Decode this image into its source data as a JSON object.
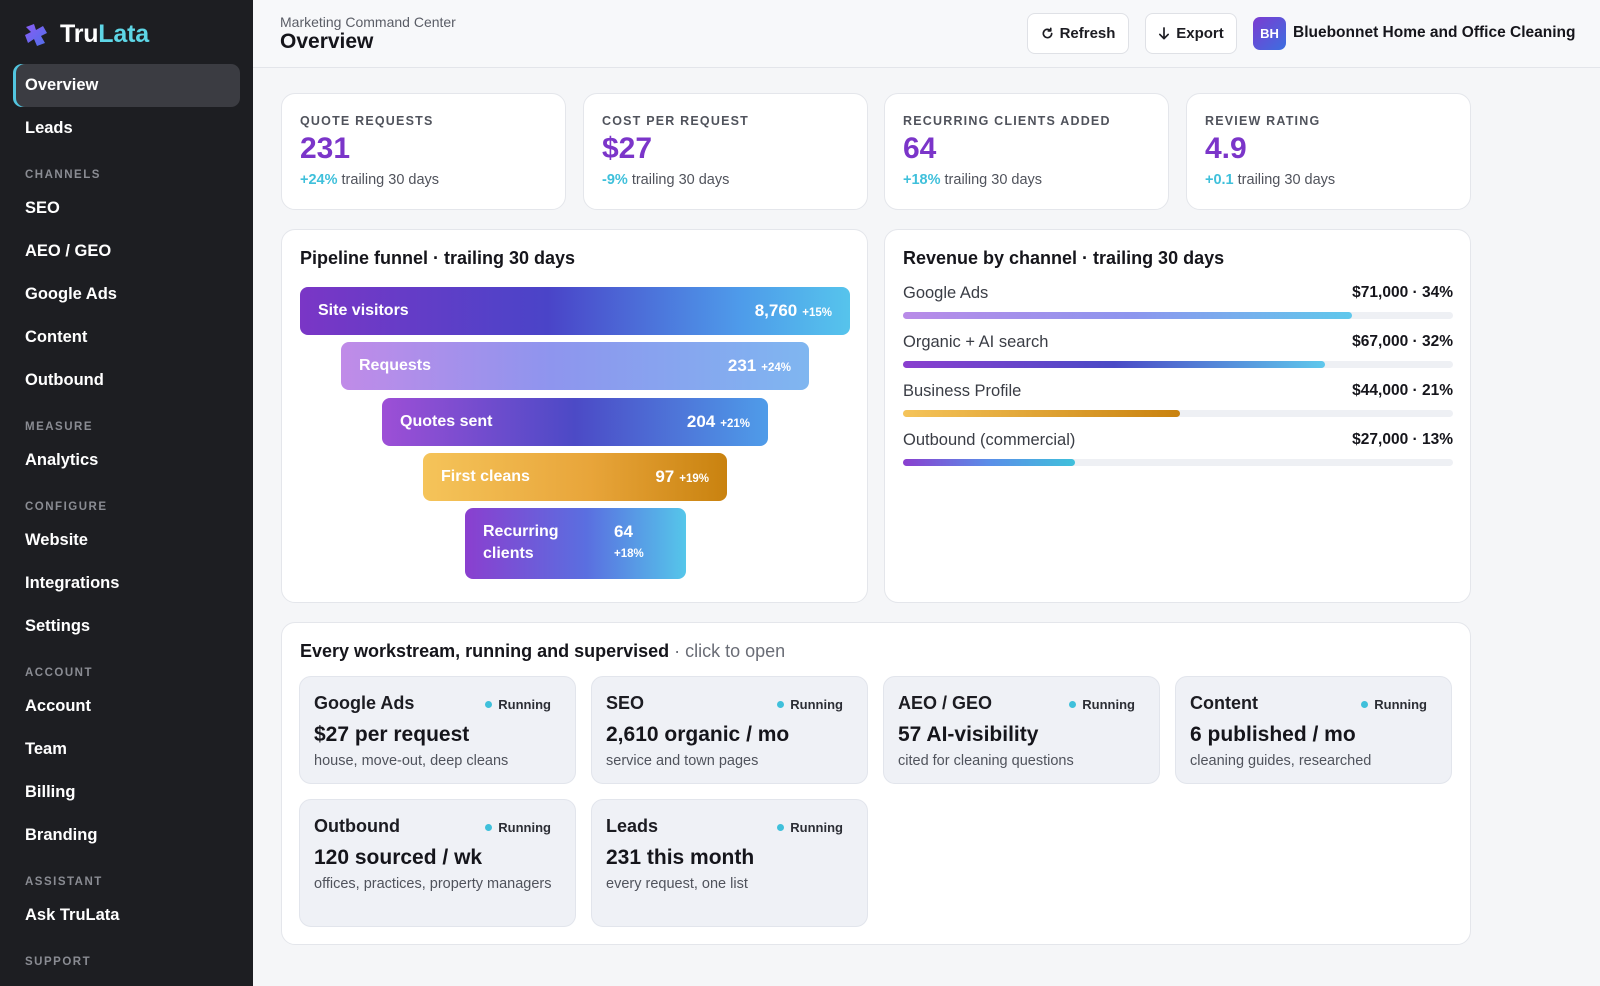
{
  "brand": {
    "name_part1": "Tru",
    "name_part2": "Lata"
  },
  "sidebar": {
    "items": [
      {
        "label": "Overview",
        "active": true
      },
      {
        "label": "Leads"
      },
      {
        "section": "CHANNELS"
      },
      {
        "label": "SEO"
      },
      {
        "label": "AEO / GEO"
      },
      {
        "label": "Google Ads"
      },
      {
        "label": "Content"
      },
      {
        "label": "Outbound"
      },
      {
        "section": "MEASURE"
      },
      {
        "label": "Analytics"
      },
      {
        "section": "CONFIGURE"
      },
      {
        "label": "Website"
      },
      {
        "label": "Integrations"
      },
      {
        "label": "Settings"
      },
      {
        "section": "ACCOUNT"
      },
      {
        "label": "Account"
      },
      {
        "label": "Team"
      },
      {
        "label": "Billing"
      },
      {
        "label": "Branding"
      },
      {
        "section": "ASSISTANT"
      },
      {
        "label": "Ask TruLata"
      },
      {
        "section": "SUPPORT"
      }
    ]
  },
  "header": {
    "subtitle": "Marketing Command Center",
    "title": "Overview",
    "refresh_label": "Refresh",
    "export_label": "Export",
    "avatar_initials": "BH",
    "business_name": "Bluebonnet Home and Office Cleaning"
  },
  "kpis": [
    {
      "label": "QUOTE REQUESTS",
      "value": "231",
      "delta": "+24%",
      "period": "trailing 30 days"
    },
    {
      "label": "COST PER REQUEST",
      "value": "$27",
      "delta": "-9%",
      "period": "trailing 30 days"
    },
    {
      "label": "RECURRING CLIENTS ADDED",
      "value": "64",
      "delta": "+18%",
      "period": "trailing 30 days"
    },
    {
      "label": "REVIEW RATING",
      "value": "4.9",
      "delta": "+0.1",
      "period": "trailing 30 days"
    }
  ],
  "funnel": {
    "title": "Pipeline funnel · trailing 30 days",
    "stages": [
      {
        "label": "Site visitors",
        "value": "8,760",
        "change": "+15%"
      },
      {
        "label": "Requests",
        "value": "231",
        "change": "+24%"
      },
      {
        "label": "Quotes sent",
        "value": "204",
        "change": "+21%"
      },
      {
        "label": "First cleans",
        "value": "97",
        "change": "+19%"
      },
      {
        "label": "Recurring clients",
        "label_line1": "Recurring",
        "label_line2": "clients",
        "value": "64",
        "change": "+18%"
      }
    ]
  },
  "revenue": {
    "title": "Revenue by channel · trailing 30 days",
    "channels": [
      {
        "name": "Google Ads",
        "value": "$71,000 · 34%",
        "fill": 0.816
      },
      {
        "name": "Organic + AI search",
        "value": "$67,000 · 32%",
        "fill": 0.768
      },
      {
        "name": "Business Profile",
        "value": "$44,000 · 21%",
        "fill": 0.504
      },
      {
        "name": "Outbound (commercial)",
        "value": "$27,000 · 13%",
        "fill": 0.312
      }
    ]
  },
  "workstreams": {
    "title": "Every workstream, running and supervised",
    "title_suffix": "· click to open",
    "items": [
      {
        "name": "Google Ads",
        "status": "Running",
        "metric": "$27 per request",
        "desc": "house, move-out, deep cleans"
      },
      {
        "name": "SEO",
        "status": "Running",
        "metric": "2,610 organic / mo",
        "desc": "service and town pages"
      },
      {
        "name": "AEO / GEO",
        "status": "Running",
        "metric": "57 AI-visibility",
        "desc": "cited for cleaning questions"
      },
      {
        "name": "Content",
        "status": "Running",
        "metric": "6 published / mo",
        "desc": "cleaning guides, researched"
      },
      {
        "name": "Outbound",
        "status": "Running",
        "metric": "120 sourced / wk",
        "desc": "offices, practices, property managers"
      },
      {
        "name": "Leads",
        "status": "Running",
        "metric": "231 this month",
        "desc": "every request, one list"
      }
    ]
  },
  "colors": {
    "accent_purple": "#7b35c9",
    "accent_cyan": "#3fc0db",
    "sidebar_bg": "#1d1e22"
  }
}
